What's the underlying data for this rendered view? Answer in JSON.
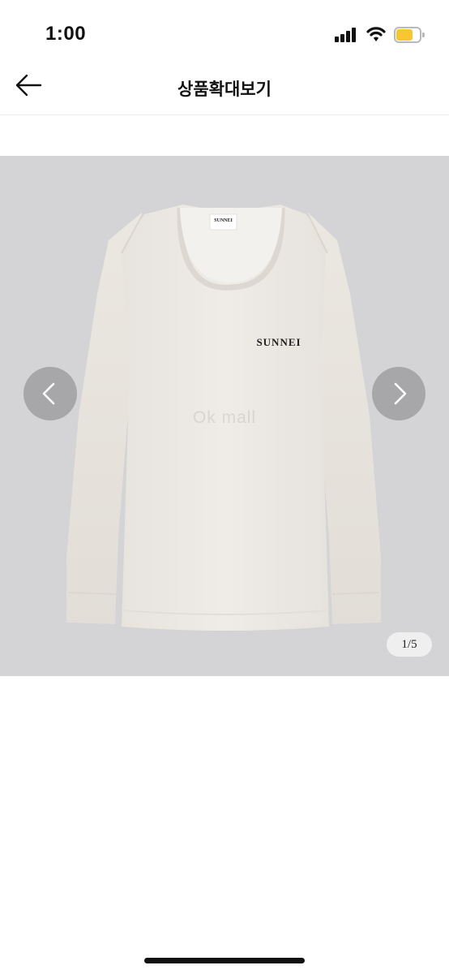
{
  "status_bar": {
    "time": "1:00",
    "signal_icon": "cellular-signal-icon",
    "wifi_icon": "wifi-icon",
    "battery_icon": "battery-icon",
    "battery_level": 0.7,
    "battery_color": "#f7c631"
  },
  "nav": {
    "back_icon": "arrow-left-icon",
    "title": "상품확대보기"
  },
  "viewer": {
    "background_color": "#d4d4d6",
    "product_brand_print": "SUNNEI",
    "neck_label": "SUNNEI",
    "watermark": "Ok mall",
    "prev_icon": "chevron-left-icon",
    "next_icon": "chevron-right-icon",
    "current_page": 1,
    "total_pages": 5,
    "page_counter": "1/5"
  }
}
